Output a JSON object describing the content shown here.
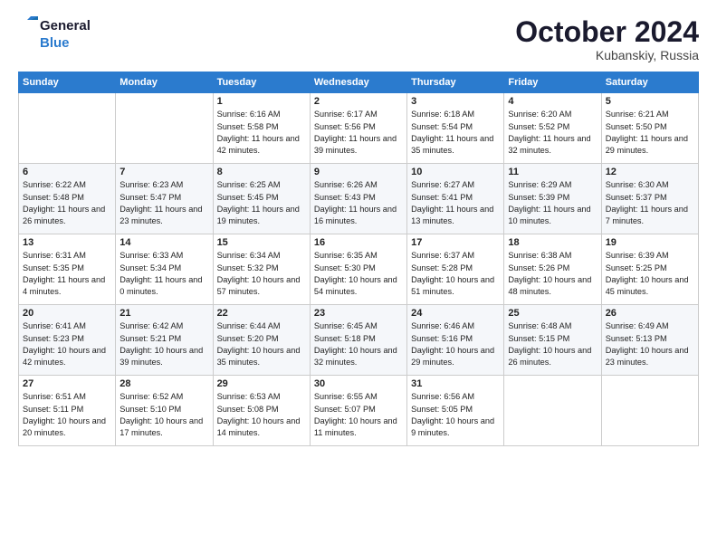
{
  "header": {
    "logo_line1": "General",
    "logo_line2": "Blue",
    "month_title": "October 2024",
    "subtitle": "Kubanskiy, Russia"
  },
  "days_of_week": [
    "Sunday",
    "Monday",
    "Tuesday",
    "Wednesday",
    "Thursday",
    "Friday",
    "Saturday"
  ],
  "weeks": [
    [
      {
        "day": "",
        "content": ""
      },
      {
        "day": "",
        "content": ""
      },
      {
        "day": "1",
        "content": "Sunrise: 6:16 AM\nSunset: 5:58 PM\nDaylight: 11 hours and 42 minutes."
      },
      {
        "day": "2",
        "content": "Sunrise: 6:17 AM\nSunset: 5:56 PM\nDaylight: 11 hours and 39 minutes."
      },
      {
        "day": "3",
        "content": "Sunrise: 6:18 AM\nSunset: 5:54 PM\nDaylight: 11 hours and 35 minutes."
      },
      {
        "day": "4",
        "content": "Sunrise: 6:20 AM\nSunset: 5:52 PM\nDaylight: 11 hours and 32 minutes."
      },
      {
        "day": "5",
        "content": "Sunrise: 6:21 AM\nSunset: 5:50 PM\nDaylight: 11 hours and 29 minutes."
      }
    ],
    [
      {
        "day": "6",
        "content": "Sunrise: 6:22 AM\nSunset: 5:48 PM\nDaylight: 11 hours and 26 minutes."
      },
      {
        "day": "7",
        "content": "Sunrise: 6:23 AM\nSunset: 5:47 PM\nDaylight: 11 hours and 23 minutes."
      },
      {
        "day": "8",
        "content": "Sunrise: 6:25 AM\nSunset: 5:45 PM\nDaylight: 11 hours and 19 minutes."
      },
      {
        "day": "9",
        "content": "Sunrise: 6:26 AM\nSunset: 5:43 PM\nDaylight: 11 hours and 16 minutes."
      },
      {
        "day": "10",
        "content": "Sunrise: 6:27 AM\nSunset: 5:41 PM\nDaylight: 11 hours and 13 minutes."
      },
      {
        "day": "11",
        "content": "Sunrise: 6:29 AM\nSunset: 5:39 PM\nDaylight: 11 hours and 10 minutes."
      },
      {
        "day": "12",
        "content": "Sunrise: 6:30 AM\nSunset: 5:37 PM\nDaylight: 11 hours and 7 minutes."
      }
    ],
    [
      {
        "day": "13",
        "content": "Sunrise: 6:31 AM\nSunset: 5:35 PM\nDaylight: 11 hours and 4 minutes."
      },
      {
        "day": "14",
        "content": "Sunrise: 6:33 AM\nSunset: 5:34 PM\nDaylight: 11 hours and 0 minutes."
      },
      {
        "day": "15",
        "content": "Sunrise: 6:34 AM\nSunset: 5:32 PM\nDaylight: 10 hours and 57 minutes."
      },
      {
        "day": "16",
        "content": "Sunrise: 6:35 AM\nSunset: 5:30 PM\nDaylight: 10 hours and 54 minutes."
      },
      {
        "day": "17",
        "content": "Sunrise: 6:37 AM\nSunset: 5:28 PM\nDaylight: 10 hours and 51 minutes."
      },
      {
        "day": "18",
        "content": "Sunrise: 6:38 AM\nSunset: 5:26 PM\nDaylight: 10 hours and 48 minutes."
      },
      {
        "day": "19",
        "content": "Sunrise: 6:39 AM\nSunset: 5:25 PM\nDaylight: 10 hours and 45 minutes."
      }
    ],
    [
      {
        "day": "20",
        "content": "Sunrise: 6:41 AM\nSunset: 5:23 PM\nDaylight: 10 hours and 42 minutes."
      },
      {
        "day": "21",
        "content": "Sunrise: 6:42 AM\nSunset: 5:21 PM\nDaylight: 10 hours and 39 minutes."
      },
      {
        "day": "22",
        "content": "Sunrise: 6:44 AM\nSunset: 5:20 PM\nDaylight: 10 hours and 35 minutes."
      },
      {
        "day": "23",
        "content": "Sunrise: 6:45 AM\nSunset: 5:18 PM\nDaylight: 10 hours and 32 minutes."
      },
      {
        "day": "24",
        "content": "Sunrise: 6:46 AM\nSunset: 5:16 PM\nDaylight: 10 hours and 29 minutes."
      },
      {
        "day": "25",
        "content": "Sunrise: 6:48 AM\nSunset: 5:15 PM\nDaylight: 10 hours and 26 minutes."
      },
      {
        "day": "26",
        "content": "Sunrise: 6:49 AM\nSunset: 5:13 PM\nDaylight: 10 hours and 23 minutes."
      }
    ],
    [
      {
        "day": "27",
        "content": "Sunrise: 6:51 AM\nSunset: 5:11 PM\nDaylight: 10 hours and 20 minutes."
      },
      {
        "day": "28",
        "content": "Sunrise: 6:52 AM\nSunset: 5:10 PM\nDaylight: 10 hours and 17 minutes."
      },
      {
        "day": "29",
        "content": "Sunrise: 6:53 AM\nSunset: 5:08 PM\nDaylight: 10 hours and 14 minutes."
      },
      {
        "day": "30",
        "content": "Sunrise: 6:55 AM\nSunset: 5:07 PM\nDaylight: 10 hours and 11 minutes."
      },
      {
        "day": "31",
        "content": "Sunrise: 6:56 AM\nSunset: 5:05 PM\nDaylight: 10 hours and 9 minutes."
      },
      {
        "day": "",
        "content": ""
      },
      {
        "day": "",
        "content": ""
      }
    ]
  ]
}
